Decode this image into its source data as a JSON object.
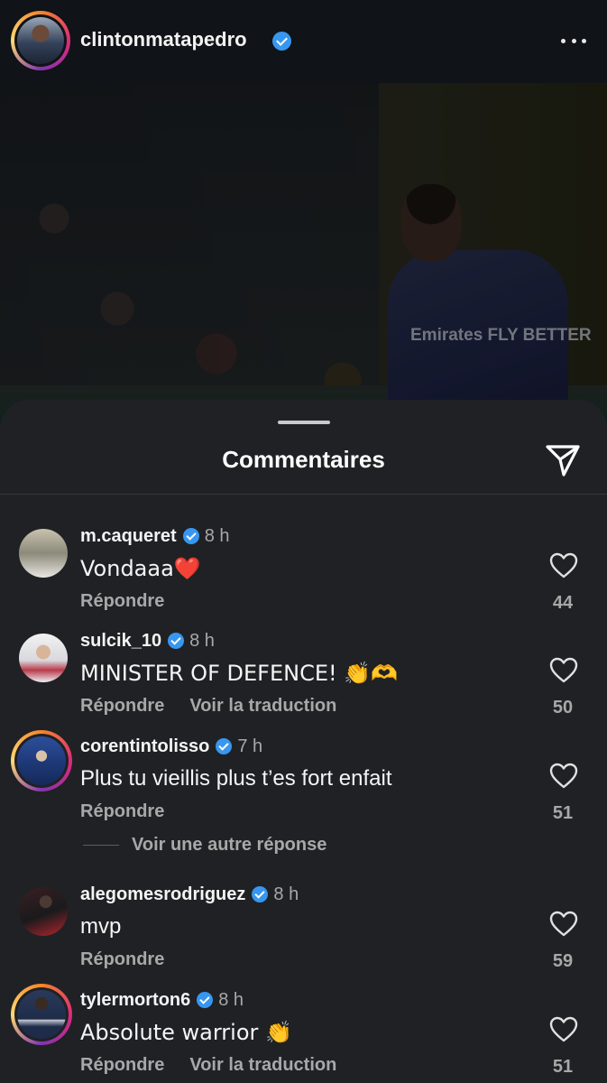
{
  "post": {
    "username": "clintonmatapedro",
    "photo_text": "Emirates FLY BETTER"
  },
  "sheet": {
    "title": "Commentaires"
  },
  "comments": [
    {
      "user": "m.caqueret",
      "time": "8 h",
      "text": "Vondaaa❤️",
      "reply": "Répondre",
      "translate": "",
      "likes": "44"
    },
    {
      "user": "sulcik_10",
      "time": "8 h",
      "text": "MINISTER OF DEFENCE! 👏🫶",
      "reply": "Répondre",
      "translate": "Voir la traduction",
      "likes": "50"
    },
    {
      "user": "corentintolisso",
      "time": "7 h",
      "text": "Plus tu vieillis plus t’es fort enfait",
      "reply": "Répondre",
      "translate": "",
      "likes": "51"
    },
    {
      "user": "alegomesrodriguez",
      "time": "8 h",
      "text": "mvp",
      "reply": "Répondre",
      "translate": "",
      "likes": "59"
    },
    {
      "user": "tylermorton6",
      "time": "8 h",
      "text": "Absolute warrior 👏",
      "reply": "Répondre",
      "translate": "Voir la traduction",
      "likes": "51"
    }
  ],
  "more_replies": "Voir une autre réponse",
  "icons": {
    "verified": "verified-badge-icon",
    "more": "more-horizontal-icon",
    "send": "send-icon",
    "like": "heart-icon"
  },
  "colors": {
    "verified": "#3797f0",
    "sheet_bg": "#202124",
    "secondary_text": "#a8a8a8"
  }
}
